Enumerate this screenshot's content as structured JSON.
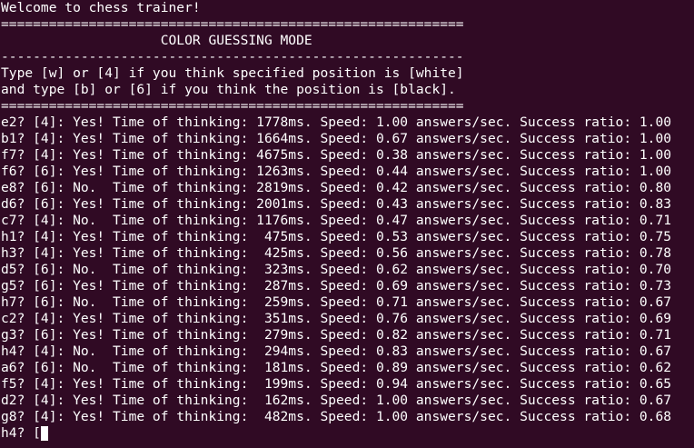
{
  "terminal": {
    "background": "#300a24",
    "foreground": "#ffffff",
    "intro": [
      "Welcome to chess trainer!",
      "==========================================================",
      "                    COLOR GUESSING MODE",
      "----------------------------------------------------------",
      "Type [w] or [4] if you think specified position is [white]",
      "and type [b] or [6] if you think the position is [black].",
      "=========================================================="
    ],
    "results": [
      "e2? [4]: Yes! Time of thinking: 1778ms. Speed: 1.00 answers/sec. Success ratio: 1.00",
      "b1? [4]: Yes! Time of thinking: 1664ms. Speed: 0.67 answers/sec. Success ratio: 1.00",
      "f7? [4]: Yes! Time of thinking: 4675ms. Speed: 0.38 answers/sec. Success ratio: 1.00",
      "f6? [6]: Yes! Time of thinking: 1263ms. Speed: 0.44 answers/sec. Success ratio: 1.00",
      "e8? [6]: No.  Time of thinking: 2819ms. Speed: 0.42 answers/sec. Success ratio: 0.80",
      "d6? [6]: Yes! Time of thinking: 2001ms. Speed: 0.43 answers/sec. Success ratio: 0.83",
      "c7? [4]: No.  Time of thinking: 1176ms. Speed: 0.47 answers/sec. Success ratio: 0.71",
      "h1? [4]: Yes! Time of thinking:  475ms. Speed: 0.53 answers/sec. Success ratio: 0.75",
      "h3? [4]: Yes! Time of thinking:  425ms. Speed: 0.56 answers/sec. Success ratio: 0.78",
      "d5? [6]: No.  Time of thinking:  323ms. Speed: 0.62 answers/sec. Success ratio: 0.70",
      "g5? [6]: Yes! Time of thinking:  287ms. Speed: 0.69 answers/sec. Success ratio: 0.73",
      "h7? [6]: No.  Time of thinking:  259ms. Speed: 0.71 answers/sec. Success ratio: 0.67",
      "c2? [4]: Yes! Time of thinking:  351ms. Speed: 0.76 answers/sec. Success ratio: 0.69",
      "g3? [6]: Yes! Time of thinking:  279ms. Speed: 0.82 answers/sec. Success ratio: 0.71",
      "h4? [4]: No.  Time of thinking:  294ms. Speed: 0.83 answers/sec. Success ratio: 0.67",
      "a6? [6]: No.  Time of thinking:  181ms. Speed: 0.89 answers/sec. Success ratio: 0.62",
      "f5? [4]: Yes! Time of thinking:  199ms. Speed: 0.94 answers/sec. Success ratio: 0.65",
      "d2? [4]: Yes! Time of thinking:  162ms. Speed: 1.00 answers/sec. Success ratio: 0.67",
      "g8? [4]: Yes! Time of thinking:  482ms. Speed: 1.00 answers/sec. Success ratio: 0.68"
    ],
    "prompt": "h4? [",
    "cursor_icon": "block-cursor"
  }
}
